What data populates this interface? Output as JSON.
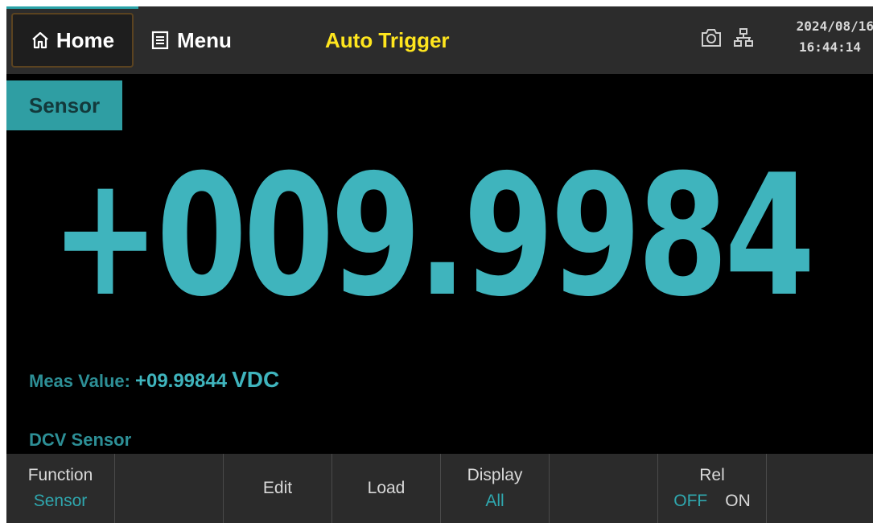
{
  "topbar": {
    "home_label": "Home",
    "menu_label": "Menu",
    "trigger_label": "Auto Trigger",
    "date": "2024/08/16",
    "time": "16:44:14",
    "icons": [
      "home-icon",
      "menu-icon",
      "camera-icon",
      "network-icon"
    ]
  },
  "mode_tag": "Sensor",
  "reading": {
    "main": "+009.9984",
    "meas_label": "Meas Value:",
    "meas_value": "+09.99844",
    "meas_unit": "VDC",
    "mode": "DCV Sensor"
  },
  "softkeys": [
    {
      "label": "Function",
      "sub": "Sensor"
    },
    {
      "label": "",
      "sub": ""
    },
    {
      "label": "Edit",
      "sub": ""
    },
    {
      "label": "Load",
      "sub": ""
    },
    {
      "label": "Display",
      "sub": "All"
    },
    {
      "label": "",
      "sub": ""
    },
    {
      "label": "Rel",
      "off": "OFF",
      "on": "ON"
    },
    {
      "label": "",
      "sub": ""
    }
  ],
  "colors": {
    "accent": "#3fb4bd",
    "trigger": "#ffe61e",
    "topbar": "#2c2c2c",
    "background": "#000000"
  }
}
